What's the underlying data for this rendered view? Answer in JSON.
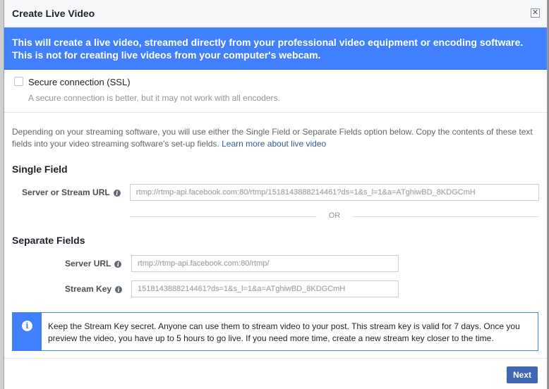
{
  "dialog": {
    "title": "Create Live Video",
    "banner": "This will create a live video, streamed directly from your professional video equipment or encoding software. This is not for creating live videos from your computer's webcam."
  },
  "ssl": {
    "label": "Secure connection (SSL)",
    "help": "A secure connection is better, but it may not work with all encoders.",
    "checked": false
  },
  "description": {
    "text": "Depending on your streaming software, you will use either the Single Field or Separate Fields option below. Copy the contents of these text fields into your video streaming software's set-up fields.",
    "link": "Learn more about live video"
  },
  "single_field": {
    "title": "Single Field",
    "label": "Server or Stream URL",
    "value": "rtmp://rtmp-api.facebook.com:80/rtmp/1518143888214461?ds=1&s_l=1&a=ATghiwBD_8KDGCmH"
  },
  "divider": {
    "text": "OR"
  },
  "separate_fields": {
    "title": "Separate Fields",
    "server_label": "Server URL",
    "server_value": "rtmp://rtmp-api.facebook.com:80/rtmp/",
    "key_label": "Stream Key",
    "key_value": "1518143888214461?ds=1&s_l=1&a=ATghiwBD_8KDGCmH"
  },
  "notice": {
    "text": "Keep the Stream Key secret. Anyone can use them to stream video to your post. This stream key is valid for 7 days. Once you preview the video, you have up to 5 hours to go live. If you need more time, create a new stream key closer to the time."
  },
  "footer": {
    "next_label": "Next"
  },
  "colors": {
    "accent": "#4080ff",
    "primary_button": "#4267b2",
    "link": "#365899"
  }
}
